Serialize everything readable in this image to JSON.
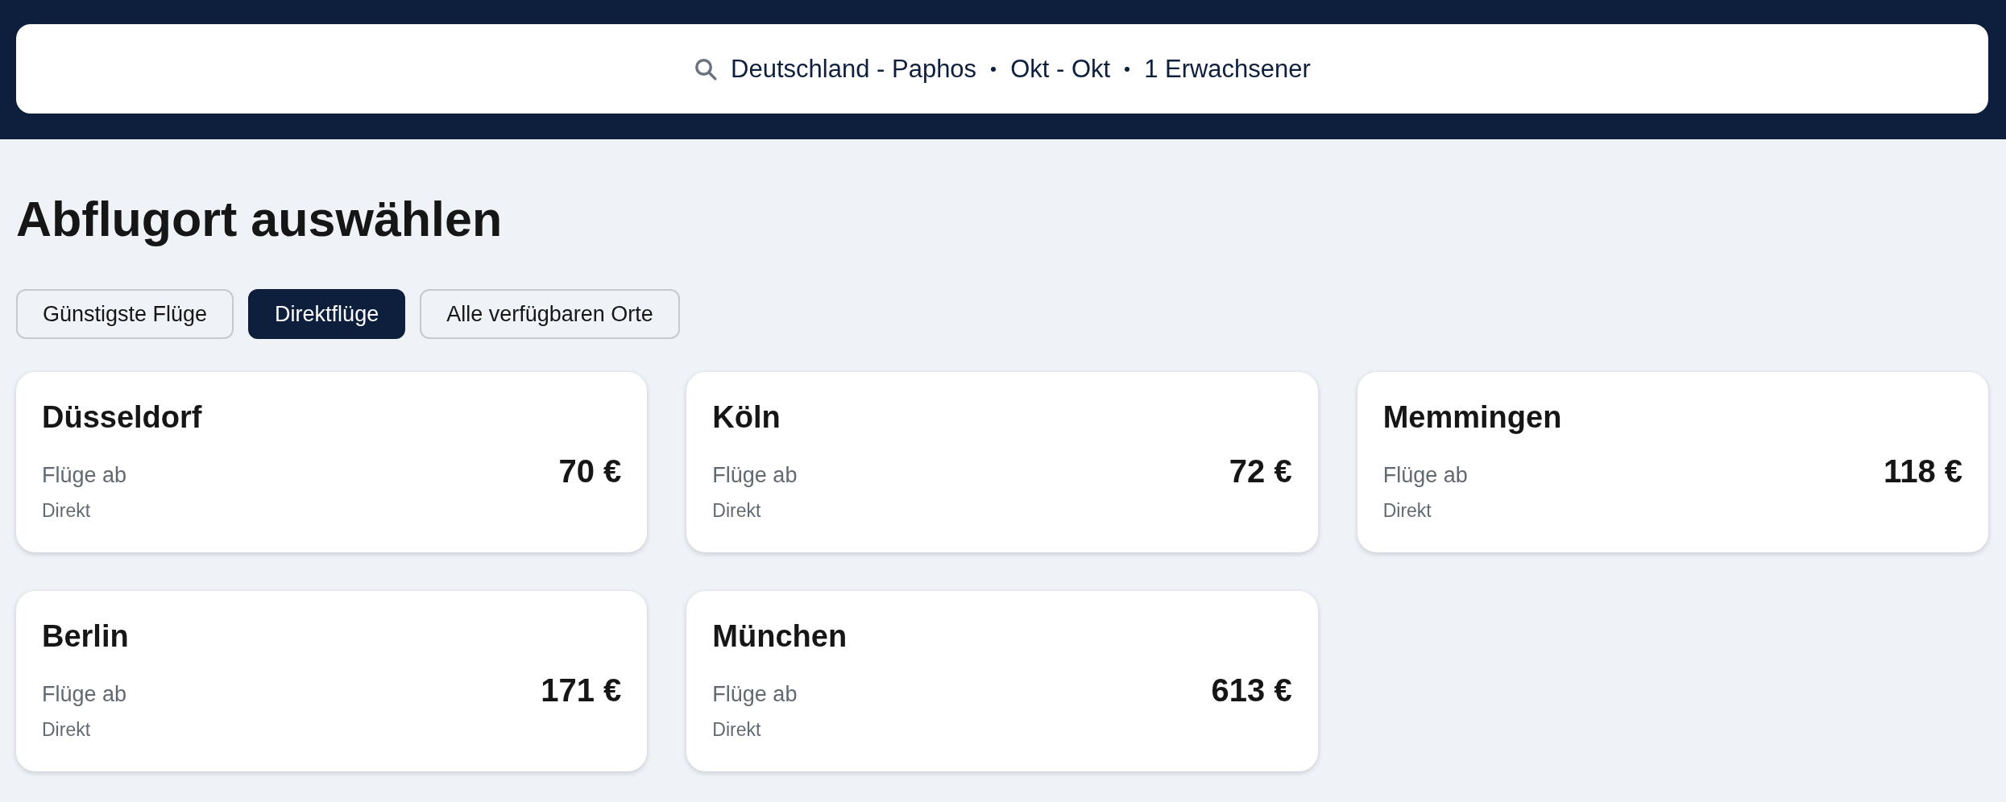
{
  "search_bar": {
    "segments": [
      "Deutschland - Paphos",
      "Okt - Okt",
      "1 Erwachsener"
    ]
  },
  "title": "Abflugort auswählen",
  "filters": [
    {
      "label": "Günstigste Flüge",
      "selected": false
    },
    {
      "label": "Direktflüge",
      "selected": true
    },
    {
      "label": "Alle verfügbaren Orte",
      "selected": false
    }
  ],
  "origins": [
    {
      "city": "Düsseldorf",
      "price_label": "Flüge ab",
      "price": "70 €",
      "stops": "Direkt"
    },
    {
      "city": "Köln",
      "price_label": "Flüge ab",
      "price": "72 €",
      "stops": "Direkt"
    },
    {
      "city": "Memmingen",
      "price_label": "Flüge ab",
      "price": "118 €",
      "stops": "Direkt"
    },
    {
      "city": "Berlin",
      "price_label": "Flüge ab",
      "price": "171 €",
      "stops": "Direkt"
    },
    {
      "city": "München",
      "price_label": "Flüge ab",
      "price": "613 €",
      "stops": "Direkt"
    }
  ]
}
